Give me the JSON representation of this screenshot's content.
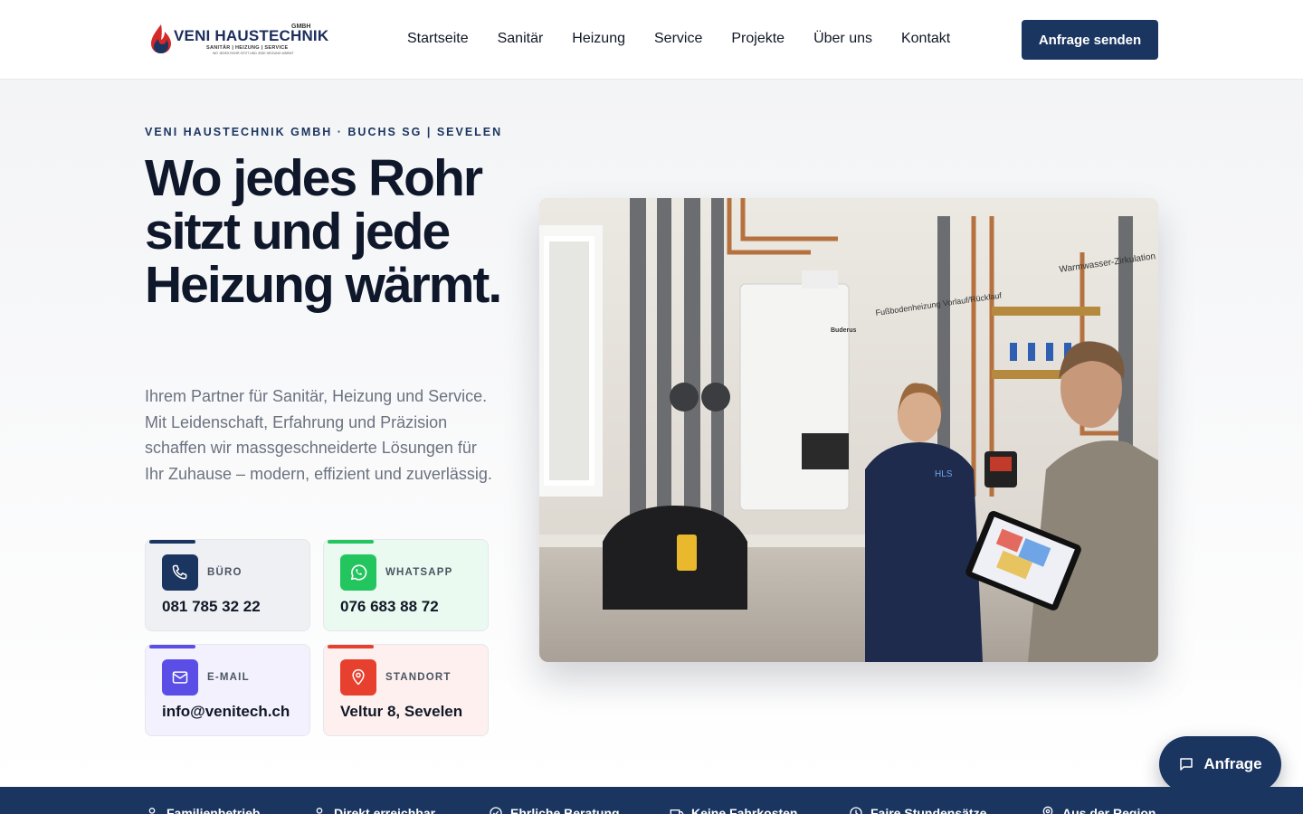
{
  "header": {
    "logo": {
      "brand": "VENI HAUSTECHNIK",
      "legal": "GMBH",
      "tagline": "SANITÄR | HEIZUNG | SERVICE",
      "subline": "WO JEDES ROHR SITZT UND JEDE HEIZUNG WÄRMT"
    },
    "nav": [
      "Startseite",
      "Sanitär",
      "Heizung",
      "Service",
      "Projekte",
      "Über uns",
      "Kontakt"
    ],
    "cta_label": "Anfrage senden"
  },
  "hero": {
    "eyebrow": "VENI HAUSTECHNIK GMBH · BUCHS SG | SEVELEN",
    "headline": "Wo jedes Rohr sitzt und jede Heizung wärmt.",
    "lead": "Ihrem Partner für Sanitär, Heizung und Service. Mit Leidenschaft, Erfahrung und Präzision schaffen wir massgeschneiderte Lösungen für Ihr Zuhause – modern, effizient und zuverlässig.",
    "contacts": {
      "office": {
        "label": "BÜRO",
        "value": "081 785 32 22",
        "icon": "phone-icon",
        "color": "#1b3561"
      },
      "whatsapp": {
        "label": "WHATSAPP",
        "value": "076 683 88 72",
        "icon": "whatsapp-icon",
        "color": "#22c55e"
      },
      "email": {
        "label": "E-MAIL",
        "value": "info@venitech.ch",
        "icon": "mail-icon",
        "color": "#5b4ee6"
      },
      "location": {
        "label": "STANDORT",
        "value": "Veltur 8, Sevelen",
        "icon": "map-pin-icon",
        "color": "#e8402f"
      }
    },
    "image": {
      "labels": [
        "Warmwasser-Zirkulation",
        "Fußbodenheizung Vorlauf/Rücklauf",
        "Buderus",
        "HLS"
      ]
    }
  },
  "floating_button": {
    "label": "Anfrage",
    "icon": "chat-icon"
  },
  "usp_band": {
    "items": [
      "Familienbetrieb",
      "Direkt erreichbar",
      "Ehrliche Beratung",
      "Keine Fahrkosten",
      "Faire Stundensätze",
      "Aus der Region"
    ]
  },
  "colors": {
    "primary": "#1b3561",
    "whatsapp": "#22c55e",
    "email": "#5b4ee6",
    "location": "#e8402f"
  }
}
